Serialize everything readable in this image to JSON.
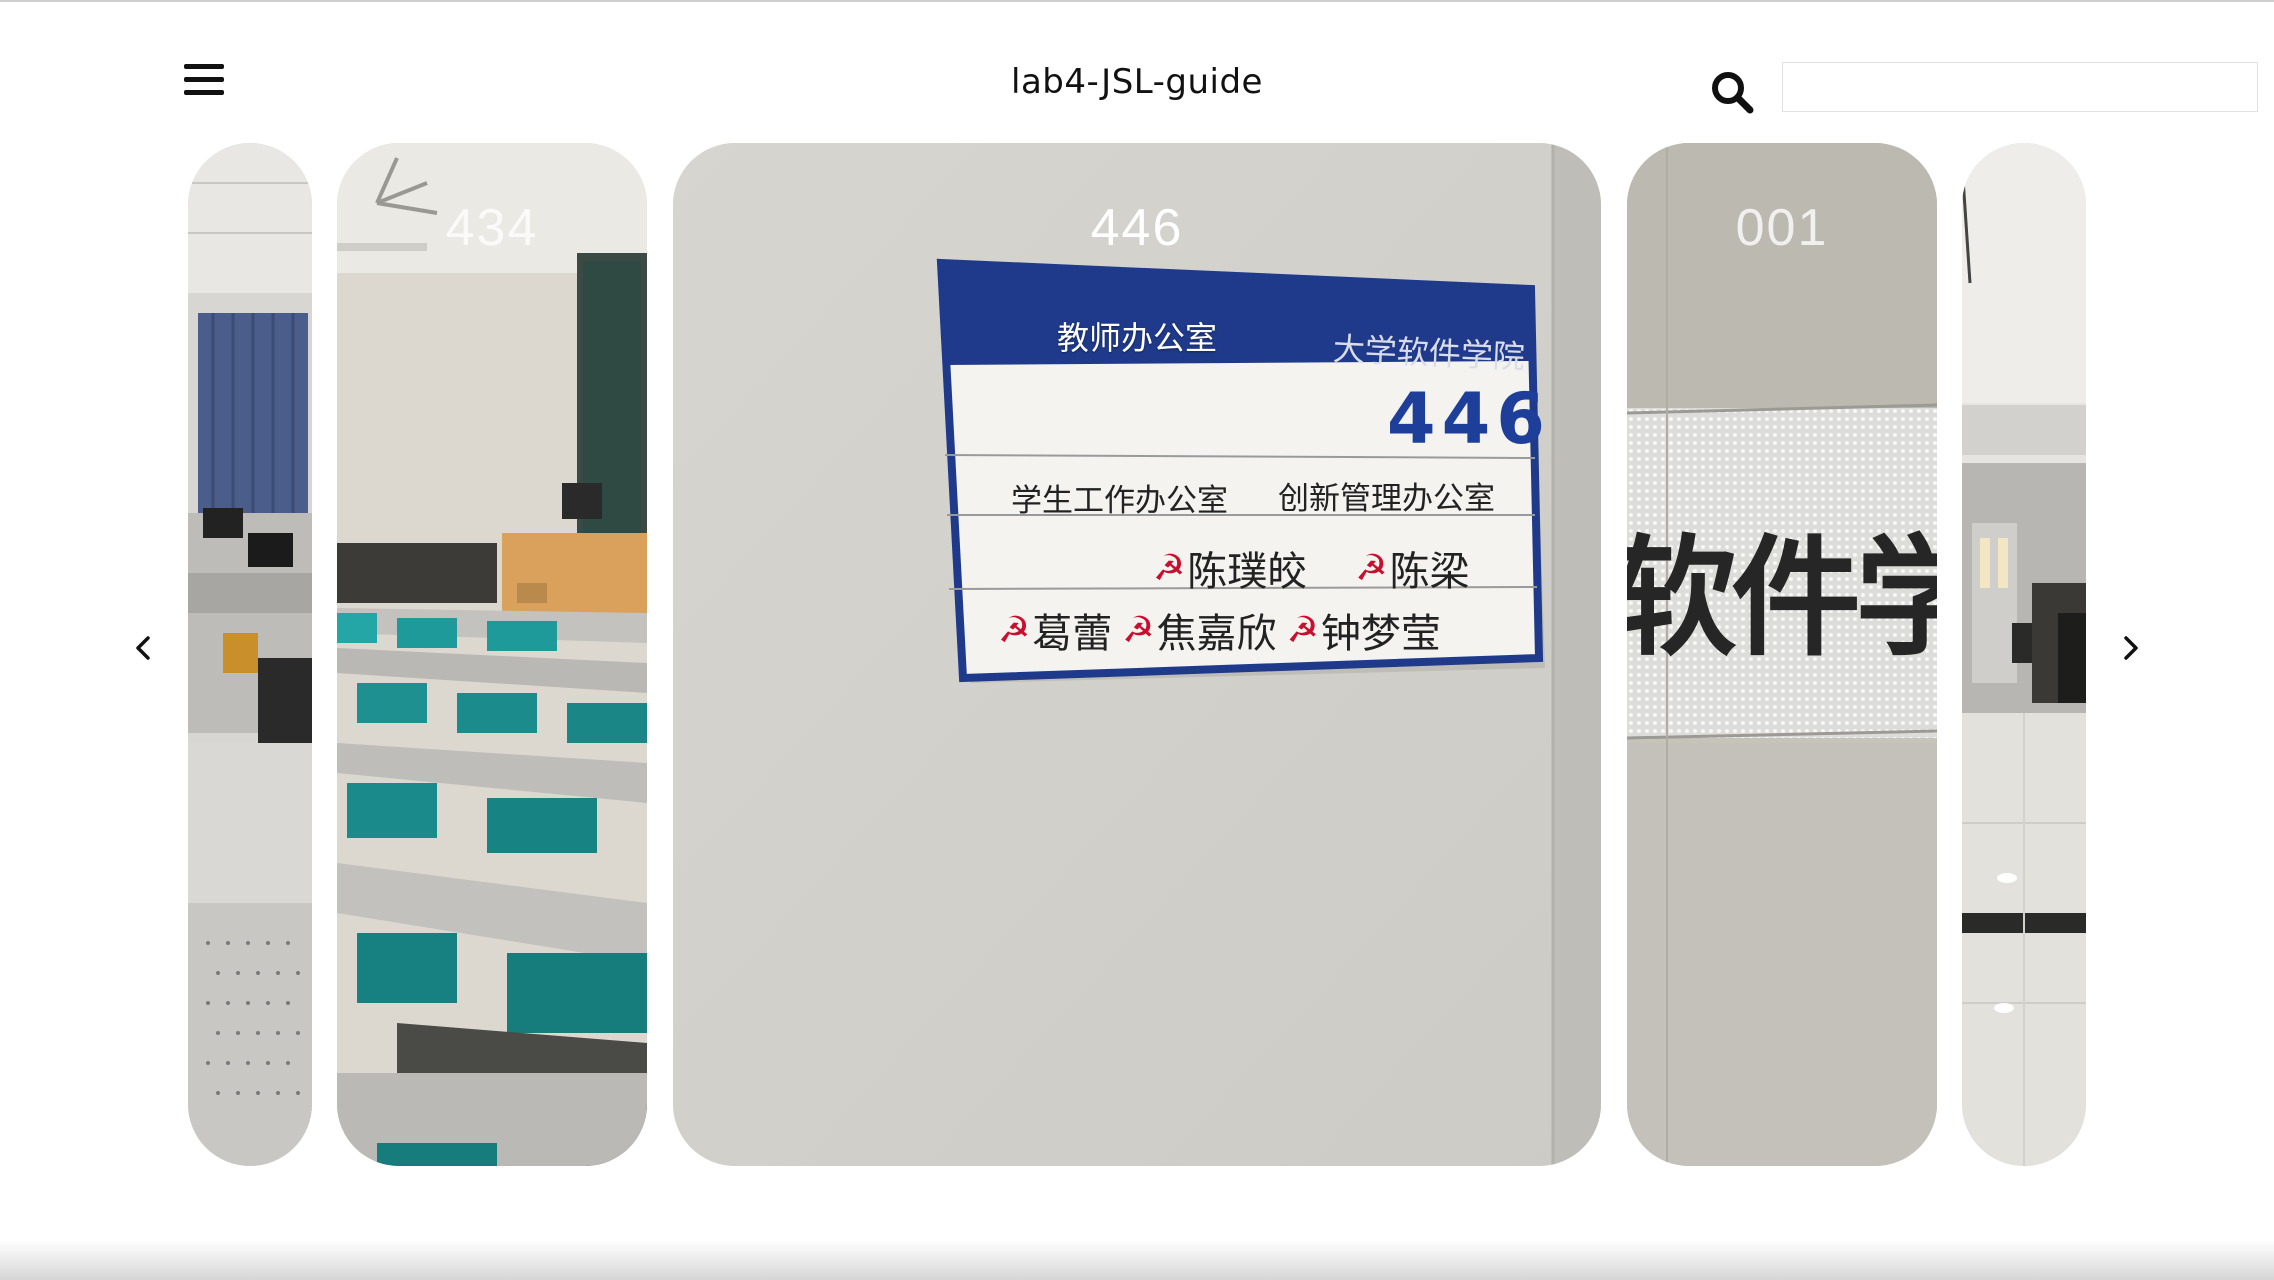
{
  "header": {
    "title": "lab4-JSL-guide",
    "search": {
      "value": "",
      "placeholder": ""
    }
  },
  "carousel": {
    "prev_icon": "chevron-left-icon",
    "next_icon": "chevron-right-icon",
    "cards": [
      {
        "label": "",
        "scene": "classroom with computers"
      },
      {
        "label": "434",
        "scene": "classroom desks"
      },
      {
        "label": "446",
        "scene": "office door sign",
        "overlay": "教师办公室",
        "active": true
      },
      {
        "label": "001",
        "scene": "wall lettering"
      },
      {
        "label": "",
        "scene": "hallway"
      }
    ],
    "sign": {
      "header": "大学软件学院",
      "room": "446",
      "offices": [
        "学生工作办公室",
        "创新管理办公室"
      ],
      "row1": [
        "陈璞皎",
        "陈梁"
      ],
      "row2": [
        "葛蕾",
        "焦嘉欣",
        "钟梦莹"
      ]
    },
    "wall_text": "软件学"
  },
  "colors": {
    "sign_blue": "#1f3a8a",
    "room_number": "#1e3f99",
    "party_red": "#c8102e",
    "chair_teal": "#1f9a9a"
  }
}
